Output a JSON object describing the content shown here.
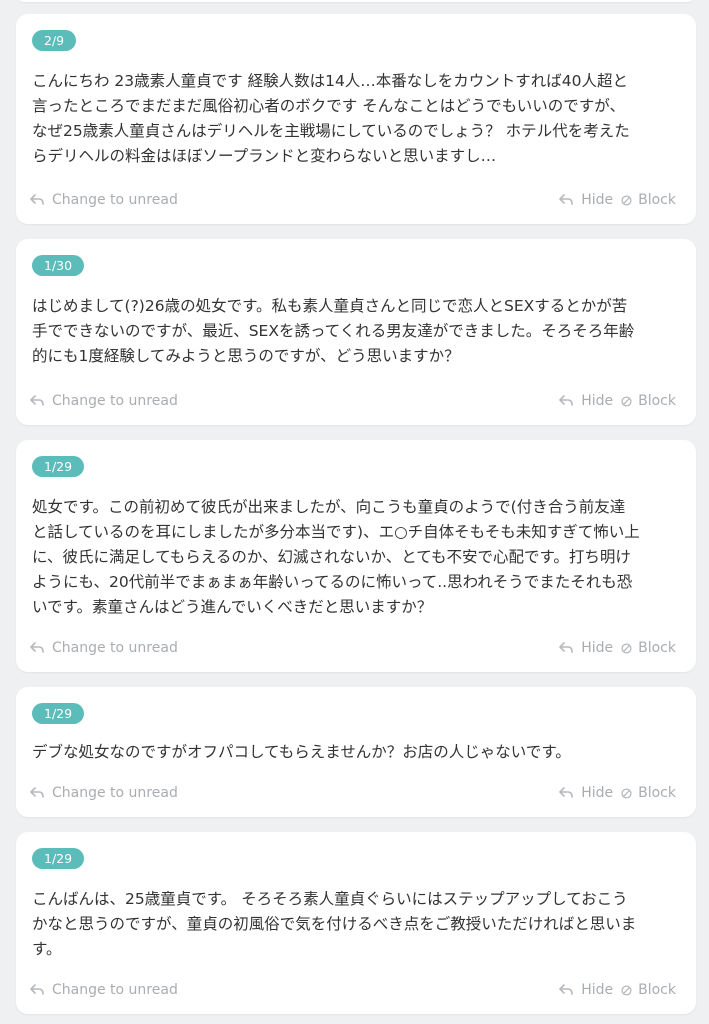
{
  "actions": {
    "change_to_unread": "Change to unread",
    "hide": "Hide",
    "block": "Block"
  },
  "messages": [
    {
      "date": "2/9",
      "text": "こんにちわ 23歳素人童貞です 経験人数は14人…本番なしをカウントすれば40人超と\n言ったところでまだまだ風俗初心者のボクです そんなことはどうでもいいのですが、\nなぜ25歳素人童貞さんはデリヘルを主戦場にしているのでしょう？ ホテル代を考えた\nらデリヘルの料金はほぼソープランドと変わらないと思いますし…"
    },
    {
      "date": "1/30",
      "text": "はじめまして(?)26歳の処女です。私も素人童貞さんと同じで恋人とSEXするとかが苦\n手でできないのですが、最近、SEXを誘ってくれる男友達ができました。そろそろ年齢\n的にも1度経験してみようと思うのですが、どう思いますか？"
    },
    {
      "date": "1/29",
      "text": "処女です。この前初めて彼氏が出来ましたが、向こうも童貞のようで(付き合う前友達\nと話しているのを耳にしましたが多分本当です)、エ○チ自体そもそも未知すぎて怖い上\nに、彼氏に満足してもらえるのか、幻滅されないか、とても不安で心配です。打ち明け\nようにも、20代前半でまぁまぁ年齢いってるのに怖いって..思われそうでまたそれも恐\nいです。素童さんはどう進んでいくべきだと思いますか？"
    },
    {
      "date": "1/29",
      "text": "デブな処女なのですがオフパコしてもらえませんか？お店の人じゃないです。"
    },
    {
      "date": "1/29",
      "text": "こんばんは、25歳童貞です。 そろそろ素人童貞ぐらいにはステップアップしておこう\nかなと思うのですが、童貞の初風俗で気を付けるべき点をご教授いただければと思いま\nす。"
    }
  ]
}
